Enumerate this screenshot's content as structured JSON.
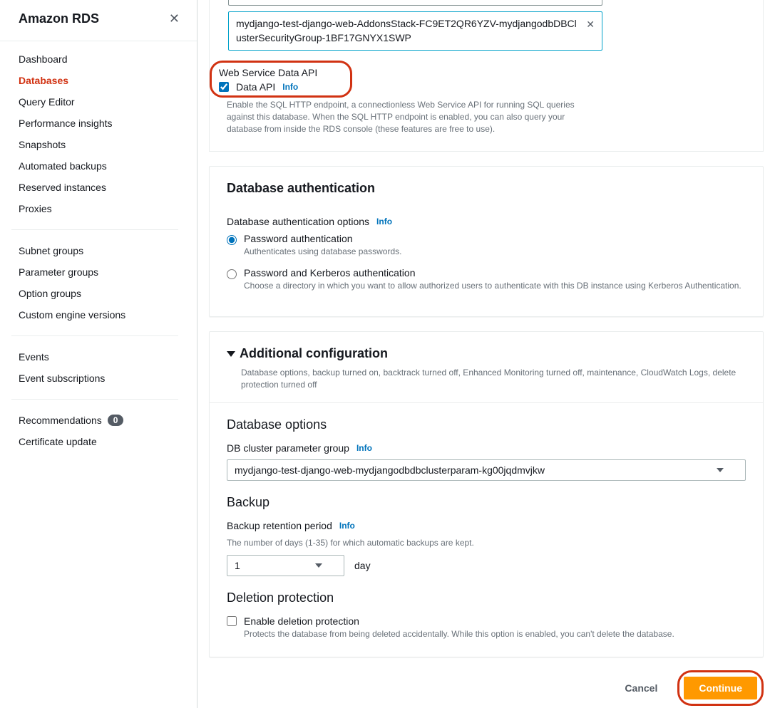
{
  "sidebar": {
    "title": "Amazon RDS",
    "items": [
      {
        "label": "Dashboard"
      },
      {
        "label": "Databases",
        "active": true
      },
      {
        "label": "Query Editor"
      },
      {
        "label": "Performance insights"
      },
      {
        "label": "Snapshots"
      },
      {
        "label": "Automated backups"
      },
      {
        "label": "Reserved instances"
      },
      {
        "label": "Proxies"
      }
    ],
    "group2": [
      {
        "label": "Subnet groups"
      },
      {
        "label": "Parameter groups"
      },
      {
        "label": "Option groups"
      },
      {
        "label": "Custom engine versions"
      }
    ],
    "group3": [
      {
        "label": "Events"
      },
      {
        "label": "Event subscriptions"
      }
    ],
    "group4": [
      {
        "label": "Recommendations",
        "badge": "0"
      },
      {
        "label": "Certificate update"
      }
    ]
  },
  "chip": {
    "text": "mydjango-test-django-web-AddonsStack-FC9ET2QR6YZV-mydjangodbDBClusterSecurityGroup-1BF17GNYX1SWP"
  },
  "data_api": {
    "heading": "Web Service Data API",
    "checkbox_label": "Data API",
    "info": "Info",
    "help": "Enable the SQL HTTP endpoint, a connectionless Web Service API for running SQL queries against this database. When the SQL HTTP endpoint is enabled, you can also query your database from inside the RDS console (these features are free to use)."
  },
  "auth": {
    "title": "Database authentication",
    "options_label": "Database authentication options",
    "info": "Info",
    "opt1_title": "Password authentication",
    "opt1_help": "Authenticates using database passwords.",
    "opt2_title": "Password and Kerberos authentication",
    "opt2_help": "Choose a directory in which you want to allow authorized users to authenticate with this DB instance using Kerberos Authentication."
  },
  "additional": {
    "title": "Additional configuration",
    "summary": "Database options, backup turned on, backtrack turned off, Enhanced Monitoring turned off, maintenance, CloudWatch Logs, delete protection turned off",
    "db_options_title": "Database options",
    "pg_label": "DB cluster parameter group",
    "pg_info": "Info",
    "pg_value": "mydjango-test-django-web-mydjangodbdbclusterparam-kg00jqdmvjkw",
    "backup_title": "Backup",
    "brp_label": "Backup retention period",
    "brp_info": "Info",
    "brp_help": "The number of days (1-35) for which automatic backups are kept.",
    "brp_value": "1",
    "brp_unit": "day",
    "del_title": "Deletion protection",
    "del_checkbox": "Enable deletion protection",
    "del_help": "Protects the database from being deleted accidentally. While this option is enabled, you can't delete the database."
  },
  "footer": {
    "cancel": "Cancel",
    "continue": "Continue"
  }
}
